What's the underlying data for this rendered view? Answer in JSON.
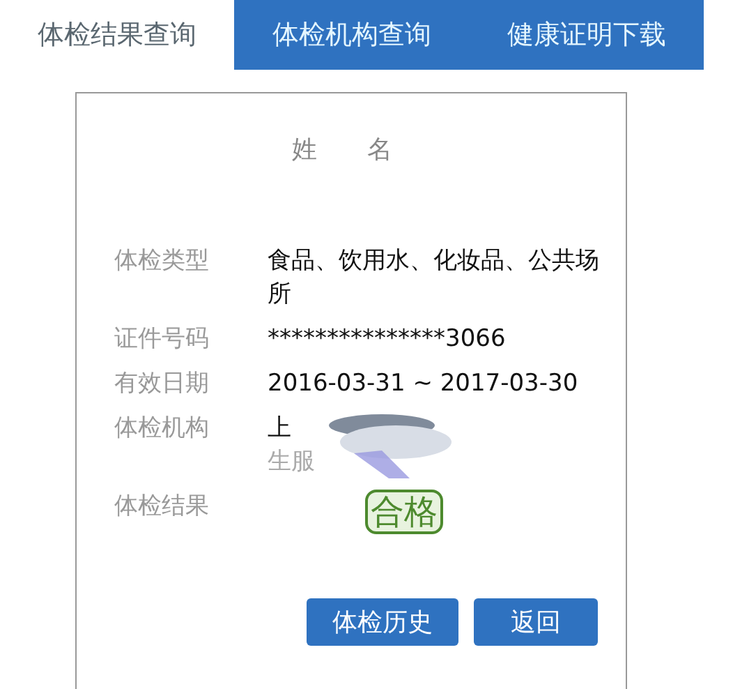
{
  "tabs": [
    {
      "label": "体检结果查询",
      "selected": true
    },
    {
      "label": "体检机构查询",
      "selected": false
    },
    {
      "label": "健康证明下载",
      "selected": false
    }
  ],
  "name_label": "姓　　名",
  "fields": [
    {
      "label": "体检类型",
      "value": "食品、饮用水、化妆品、公共场所"
    },
    {
      "label": "证件号码",
      "value": "***************3066"
    },
    {
      "label": "有效日期",
      "value": "2016-03-31 ~ 2017-03-30"
    },
    {
      "label": "体检机构",
      "value": "上",
      "value_2": "生服",
      "redacted": true
    }
  ],
  "result": {
    "label": "体检结果",
    "badge": "合格"
  },
  "buttons": [
    "体检历史",
    "返回"
  ]
}
